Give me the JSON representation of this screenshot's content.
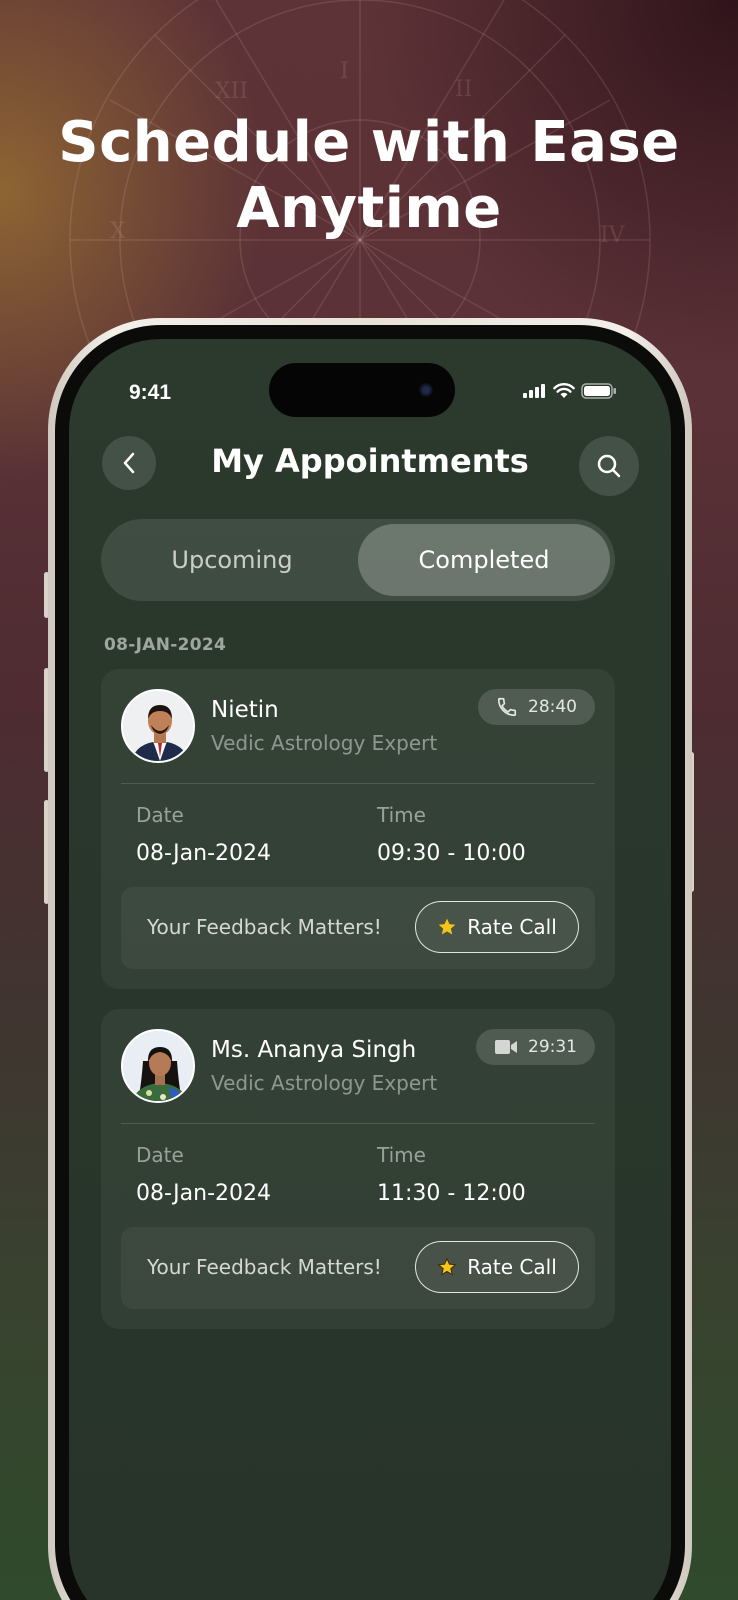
{
  "headline": {
    "line1": "Schedule with Ease",
    "line2": "Anytime"
  },
  "status_bar": {
    "time": "9:41"
  },
  "header": {
    "title": "My Appointments"
  },
  "tabs": [
    {
      "label": "Upcoming",
      "active": false
    },
    {
      "label": "Completed",
      "active": true
    }
  ],
  "section": {
    "date": "08-JAN-2024"
  },
  "appointments": [
    {
      "name": "Nietin",
      "expertise": "Vedic Astrology Expert",
      "call_type": "phone-icon",
      "duration": "28:40",
      "date_label": "Date",
      "date": "08-Jan-2024",
      "time_label": "Time",
      "time": "09:30 - 10:00",
      "feedback_text": "Your Feedback Matters!",
      "rate_label": "Rate Call"
    },
    {
      "name": "Ms. Ananya Singh",
      "expertise": "Vedic Astrology Expert",
      "call_type": "video-icon",
      "duration": "29:31",
      "date_label": "Date",
      "date": "08-Jan-2024",
      "time_label": "Time",
      "time": "11:30 - 12:00",
      "feedback_text": "Your Feedback Matters!",
      "rate_label": "Rate Call"
    }
  ],
  "colors": {
    "star": "#f5c518",
    "screen_bg": "#2b3a2d"
  }
}
